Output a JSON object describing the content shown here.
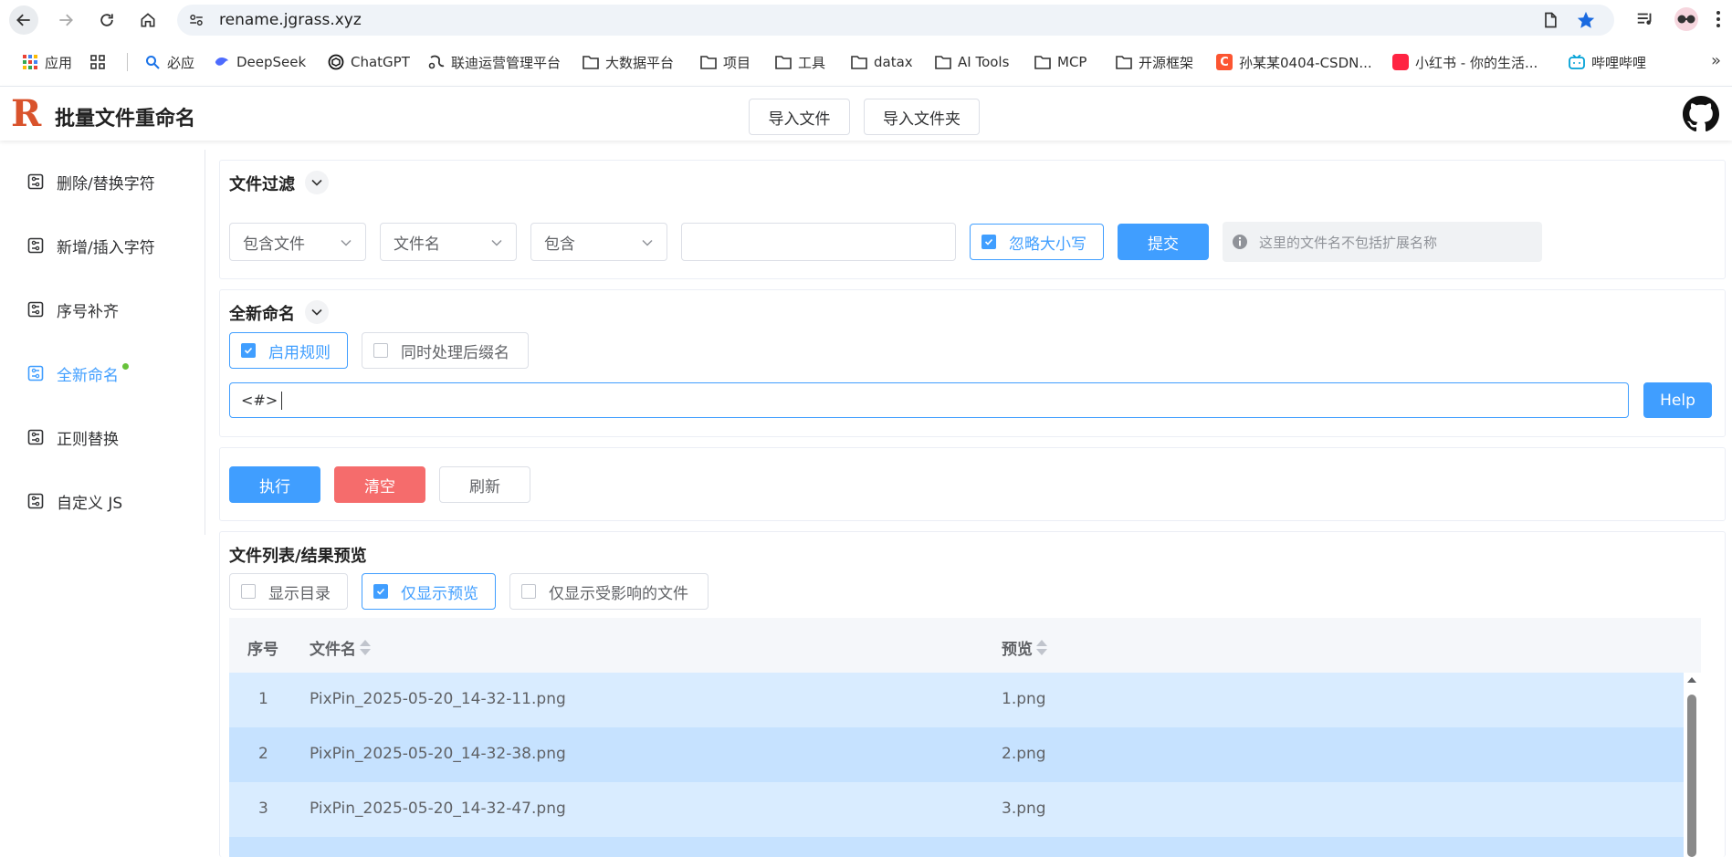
{
  "browser": {
    "url": "rename.jgrass.xyz",
    "bookmarks": [
      {
        "label": "应用",
        "icon": "apps-grid-icon"
      },
      {
        "label": "",
        "icon": "tab-groups-icon"
      },
      {
        "label": "必应",
        "icon": "bing-search-icon"
      },
      {
        "label": "DeepSeek",
        "icon": "deepseek-icon"
      },
      {
        "label": "ChatGPT",
        "icon": "chatgpt-icon"
      },
      {
        "label": "联迪运营管理平台",
        "icon": "site-icon"
      },
      {
        "label": "大数据平台",
        "icon": "folder-icon"
      },
      {
        "label": "项目",
        "icon": "folder-icon"
      },
      {
        "label": "工具",
        "icon": "folder-icon"
      },
      {
        "label": "datax",
        "icon": "folder-icon"
      },
      {
        "label": "AI Tools",
        "icon": "folder-icon"
      },
      {
        "label": "MCP",
        "icon": "folder-icon"
      },
      {
        "label": "开源框架",
        "icon": "folder-icon"
      },
      {
        "label": "孙某某0404-CSDN...",
        "icon": "csdn-icon"
      },
      {
        "label": "小红书 - 你的生活...",
        "icon": "xiaohongshu-icon"
      },
      {
        "label": "哔哩哔哩",
        "icon": "bilibili-icon"
      }
    ]
  },
  "header": {
    "logo_letter": "R",
    "title": "批量文件重命名",
    "import_files": "导入文件",
    "import_folder": "导入文件夹"
  },
  "sidebar": {
    "items": [
      {
        "label": "删除/替换字符"
      },
      {
        "label": "新增/插入字符"
      },
      {
        "label": "序号补齐"
      },
      {
        "label": "全新命名"
      },
      {
        "label": "正则替换"
      },
      {
        "label": "自定义 JS"
      }
    ]
  },
  "filter": {
    "title": "文件过滤",
    "scope_select": "包含文件",
    "field_select": "文件名",
    "op_select": "包含",
    "value": "",
    "ignore_case_label": "忽略大小写",
    "ignore_case_checked": true,
    "submit_label": "提交",
    "hint": "这里的文件名不包括扩展名称"
  },
  "rename": {
    "title": "全新命名",
    "enable_rule_label": "启用规则",
    "enable_rule_checked": true,
    "process_suffix_label": "同时处理后缀名",
    "process_suffix_checked": false,
    "pattern_value": "<#>",
    "help_label": "Help"
  },
  "actions": {
    "execute": "执行",
    "clear": "清空",
    "refresh": "刷新"
  },
  "file_list": {
    "title": "文件列表/结果预览",
    "show_dirs_label": "显示目录",
    "show_dirs_checked": false,
    "preview_only_label": "仅显示预览",
    "preview_only_checked": true,
    "affected_only_label": "仅显示受影响的文件",
    "affected_only_checked": false,
    "columns": {
      "index": "序号",
      "name": "文件名",
      "preview": "预览"
    },
    "rows": [
      {
        "index": "1",
        "name": "PixPin_2025-05-20_14-32-11.png",
        "preview": "1.png"
      },
      {
        "index": "2",
        "name": "PixPin_2025-05-20_14-32-38.png",
        "preview": "2.png"
      },
      {
        "index": "3",
        "name": "PixPin_2025-05-20_14-32-47.png",
        "preview": "3.png"
      }
    ]
  },
  "colors": {
    "primary": "#409eff",
    "danger": "#f56c6c",
    "success_dot": "#67c23a",
    "logo": "#d9532c"
  }
}
